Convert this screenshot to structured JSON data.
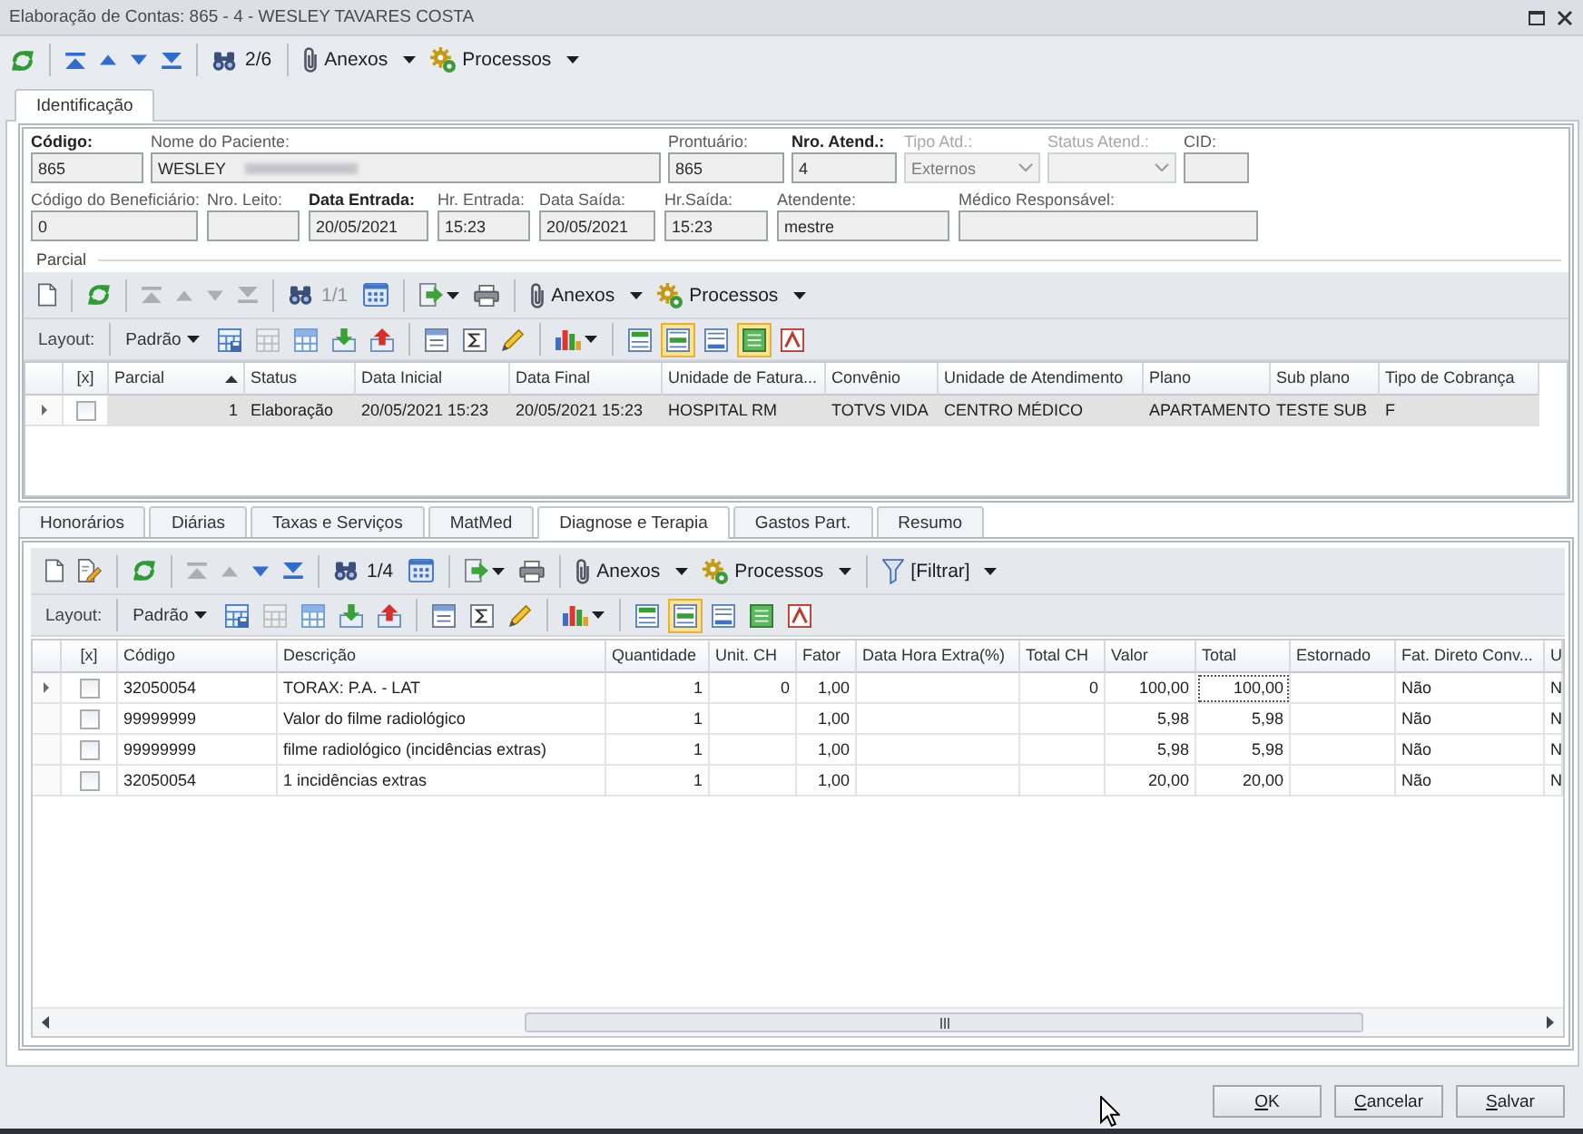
{
  "window": {
    "title": "Elaboração de Contas: 865 - 4 - WESLEY TAVARES COSTA"
  },
  "toolbar": {
    "groups": [
      [
        {
          "kind": "refresh",
          "disabled": false
        }
      ],
      [
        {
          "kind": "first",
          "disabled": false
        },
        {
          "kind": "prev",
          "disabled": false
        },
        {
          "kind": "next",
          "disabled": false
        },
        {
          "kind": "last",
          "disabled": false
        }
      ],
      [
        {
          "kind": "find",
          "disabled": false
        },
        {
          "kind": "counter",
          "text": "2/6",
          "disabled": false
        }
      ],
      [
        {
          "kind": "attach",
          "text": "Anexos",
          "disabled": false
        },
        {
          "kind": "process",
          "text": "Processos",
          "disabled": false
        }
      ]
    ]
  },
  "tabs": [
    {
      "label": "Identificação",
      "selected": true
    }
  ],
  "identification": {
    "upper_fields": [
      {
        "kind": "text",
        "label": "Código:",
        "value": "865",
        "required": true,
        "disabled": false,
        "redacted": false
      },
      {
        "kind": "text",
        "label": "Nome do Paciente:",
        "value": "WESLEY",
        "required": false,
        "disabled": false,
        "redacted": true
      },
      {
        "kind": "text",
        "label": "Prontuário:",
        "value": "865",
        "required": false,
        "disabled": false,
        "redacted": false
      },
      {
        "kind": "text",
        "label": "Nro. Atend.:",
        "value": "4",
        "required": true,
        "disabled": false,
        "redacted": false
      },
      {
        "kind": "dropdown",
        "label": "Tipo Atd.:",
        "value": "Externos",
        "required": false,
        "disabled": true,
        "redacted": false
      },
      {
        "kind": "dropdown",
        "label": "Status Atend.:",
        "required": false,
        "disabled": true,
        "redacted": false
      },
      {
        "kind": "text",
        "label": "CID:",
        "required": false,
        "disabled": false,
        "redacted": false
      }
    ],
    "lower_fields": [
      {
        "kind": "text",
        "label": "Código do Beneficiário:",
        "value": "0",
        "required": false,
        "disabled": false,
        "redacted": false
      },
      {
        "kind": "text",
        "label": "Nro. Leito:",
        "required": false,
        "disabled": false,
        "redacted": false
      },
      {
        "kind": "text",
        "label": "Data Entrada:",
        "value": "20/05/2021",
        "required": true,
        "disabled": false,
        "redacted": false
      },
      {
        "kind": "text",
        "label": "Hr. Entrada:",
        "value": "15:23",
        "required": false,
        "disabled": false,
        "redacted": false
      },
      {
        "kind": "text",
        "label": "Data Saída:",
        "value": "20/05/2021",
        "required": false,
        "disabled": false,
        "redacted": false
      },
      {
        "kind": "text",
        "label": "Hr.Saída:",
        "value": "15:23",
        "required": false,
        "disabled": false,
        "redacted": false
      },
      {
        "kind": "text",
        "label": "Atendente:",
        "value": "mestre",
        "required": false,
        "disabled": false,
        "redacted": false
      },
      {
        "kind": "text",
        "label": "Médico Responsável:",
        "required": false,
        "disabled": false,
        "redacted": false
      }
    ]
  },
  "parcial": {
    "title": "Parcial",
    "toolbar": {
      "groups": [
        [
          {
            "kind": "new",
            "disabled": false
          }
        ],
        [
          {
            "kind": "refresh",
            "disabled": false
          }
        ],
        [
          {
            "kind": "first",
            "disabled": true
          },
          {
            "kind": "prev",
            "disabled": true
          },
          {
            "kind": "next",
            "disabled": true
          },
          {
            "kind": "last",
            "disabled": true
          }
        ],
        [
          {
            "kind": "find",
            "disabled": false
          },
          {
            "kind": "counter",
            "text": "1/1",
            "disabled": true
          },
          {
            "kind": "grid",
            "disabled": false
          }
        ],
        [
          {
            "kind": "export",
            "disabled": false
          },
          {
            "kind": "print",
            "disabled": false
          }
        ],
        [
          {
            "kind": "attach",
            "text": "Anexos",
            "disabled": false
          },
          {
            "kind": "process",
            "text": "Processos",
            "disabled": false
          }
        ]
      ]
    },
    "layout_bar": {
      "label": "Layout:",
      "preset": "Padrão",
      "tools": [
        [
          {
            "kind": "save_layout",
            "disabled": false
          },
          {
            "kind": "sheet",
            "disabled": true
          },
          {
            "kind": "table",
            "disabled": false
          },
          {
            "kind": "download",
            "disabled": false
          },
          {
            "kind": "upload",
            "disabled": false
          }
        ],
        [
          {
            "kind": "columns",
            "disabled": false
          },
          {
            "kind": "sum",
            "disabled": false
          },
          {
            "kind": "marker",
            "disabled": false
          }
        ],
        [
          {
            "kind": "chart",
            "disabled": false
          }
        ]
      ],
      "view_toggles": [
        {
          "kind": "group_panel",
          "on": false
        },
        {
          "kind": "filter_row",
          "on": true
        },
        {
          "kind": "footer",
          "on": false
        },
        {
          "kind": "preview",
          "on": true
        },
        {
          "kind": "font",
          "on": false
        }
      ]
    },
    "table": {
      "check_column": "[x]",
      "columns": [
        {
          "label": "Parcial",
          "kind": "number",
          "sorted": true
        },
        {
          "label": "Status",
          "kind": "text",
          "sorted": false
        },
        {
          "label": "Data Inicial",
          "kind": "text",
          "sorted": false
        },
        {
          "label": "Data Final",
          "kind": "text",
          "sorted": false
        },
        {
          "label": "Unidade de Fatura...",
          "kind": "text",
          "sorted": false
        },
        {
          "label": "Convênio",
          "kind": "text",
          "sorted": false
        },
        {
          "label": "Unidade de Atendimento",
          "kind": "text",
          "sorted": false
        },
        {
          "label": "Plano",
          "kind": "text",
          "sorted": false
        },
        {
          "label": "Sub plano",
          "kind": "text",
          "sorted": false
        },
        {
          "label": "Tipo de Cobrança",
          "kind": "text",
          "sorted": false
        }
      ],
      "rows": [
        {
          "current": true,
          "selected": true,
          "checked": false,
          "cells": [
            "1",
            "Elaboração",
            "20/05/2021 15:23",
            "20/05/2021 15:23",
            "HOSPITAL RM",
            "TOTVS VIDA",
            "CENTRO MÉDICO",
            "APARTAMENTO",
            "TESTE SUB",
            "F"
          ]
        }
      ]
    }
  },
  "detail_tabs": [
    {
      "label": "Honorários",
      "selected": false
    },
    {
      "label": "Diárias",
      "selected": false
    },
    {
      "label": "Taxas e Serviços",
      "selected": false
    },
    {
      "label": "MatMed",
      "selected": false
    },
    {
      "label": "Diagnose e Terapia",
      "selected": true
    },
    {
      "label": "Gastos Part.",
      "selected": false
    },
    {
      "label": "Resumo",
      "selected": false
    }
  ],
  "detail": {
    "toolbar": {
      "groups": [
        [
          {
            "kind": "new",
            "disabled": false
          },
          {
            "kind": "edit",
            "disabled": false
          }
        ],
        [
          {
            "kind": "refresh",
            "disabled": false
          }
        ],
        [
          {
            "kind": "first",
            "disabled": true
          },
          {
            "kind": "prev",
            "disabled": true
          },
          {
            "kind": "next",
            "disabled": false
          },
          {
            "kind": "last",
            "disabled": false
          }
        ],
        [
          {
            "kind": "find",
            "disabled": false
          },
          {
            "kind": "counter",
            "text": "1/4",
            "disabled": false
          },
          {
            "kind": "grid",
            "disabled": false
          }
        ],
        [
          {
            "kind": "export",
            "disabled": false
          },
          {
            "kind": "print",
            "disabled": false
          }
        ],
        [
          {
            "kind": "attach",
            "text": "Anexos",
            "disabled": false
          },
          {
            "kind": "process",
            "text": "Processos",
            "disabled": false
          }
        ],
        [
          {
            "kind": "filter",
            "text": "[Filtrar]",
            "disabled": false
          }
        ]
      ]
    },
    "layout_bar": {
      "label": "Layout:",
      "preset": "Padrão",
      "tools": [
        [
          {
            "kind": "save_layout",
            "disabled": false
          },
          {
            "kind": "sheet",
            "disabled": true
          },
          {
            "kind": "table",
            "disabled": false
          },
          {
            "kind": "download",
            "disabled": false
          },
          {
            "kind": "upload",
            "disabled": false
          }
        ],
        [
          {
            "kind": "columns",
            "disabled": false
          },
          {
            "kind": "sum",
            "disabled": false
          },
          {
            "kind": "marker",
            "disabled": false
          }
        ],
        [
          {
            "kind": "chart",
            "disabled": false
          }
        ]
      ],
      "view_toggles": [
        {
          "kind": "group_panel",
          "on": false
        },
        {
          "kind": "filter_row",
          "on": true
        },
        {
          "kind": "footer",
          "on": false
        },
        {
          "kind": "preview",
          "on": false
        },
        {
          "kind": "font",
          "on": false
        }
      ]
    },
    "table": {
      "check_column": "[x]",
      "columns": [
        {
          "label": "Código",
          "kind": "text"
        },
        {
          "label": "Descrição",
          "kind": "text"
        },
        {
          "label": "Quantidade",
          "kind": "number"
        },
        {
          "label": "Unit. CH",
          "kind": "number"
        },
        {
          "label": "Fator",
          "kind": "number"
        },
        {
          "label": "Data Hora Extra(%)",
          "kind": "text"
        },
        {
          "label": "Total CH",
          "kind": "number"
        },
        {
          "label": "Valor",
          "kind": "number"
        },
        {
          "label": "Total",
          "kind": "number"
        },
        {
          "label": "Estornado",
          "kind": "text"
        },
        {
          "label": "Fat. Direto Conv...",
          "kind": "text"
        },
        {
          "label": "U",
          "kind": "text"
        }
      ],
      "rows": [
        {
          "current": true,
          "selected": false,
          "checked": false,
          "cells": [
            "32050054",
            "TORAX: P.A. - LAT",
            "1",
            "0",
            "1,00",
            "",
            "0",
            "100,00",
            {
              "text": "100,00",
              "focused": true
            },
            "",
            "Não",
            "N"
          ]
        },
        {
          "current": false,
          "selected": false,
          "checked": false,
          "cells": [
            "99999999",
            "Valor do filme radiológico",
            "1",
            "",
            "1,00",
            "",
            "",
            "5,98",
            "5,98",
            "",
            "Não",
            "N"
          ]
        },
        {
          "current": false,
          "selected": false,
          "checked": false,
          "cells": [
            "99999999",
            "filme radiológico (incidências extras)",
            "1",
            "",
            "1,00",
            "",
            "",
            "5,98",
            "5,98",
            "",
            "Não",
            "N"
          ]
        },
        {
          "current": false,
          "selected": false,
          "checked": false,
          "cells": [
            "32050054",
            "1 incidências extras",
            "1",
            "",
            "1,00",
            "",
            "",
            "20,00",
            "20,00",
            "",
            "Não",
            "N"
          ]
        }
      ]
    }
  },
  "buttons": [
    "OK",
    "Cancelar",
    "Salvar"
  ]
}
